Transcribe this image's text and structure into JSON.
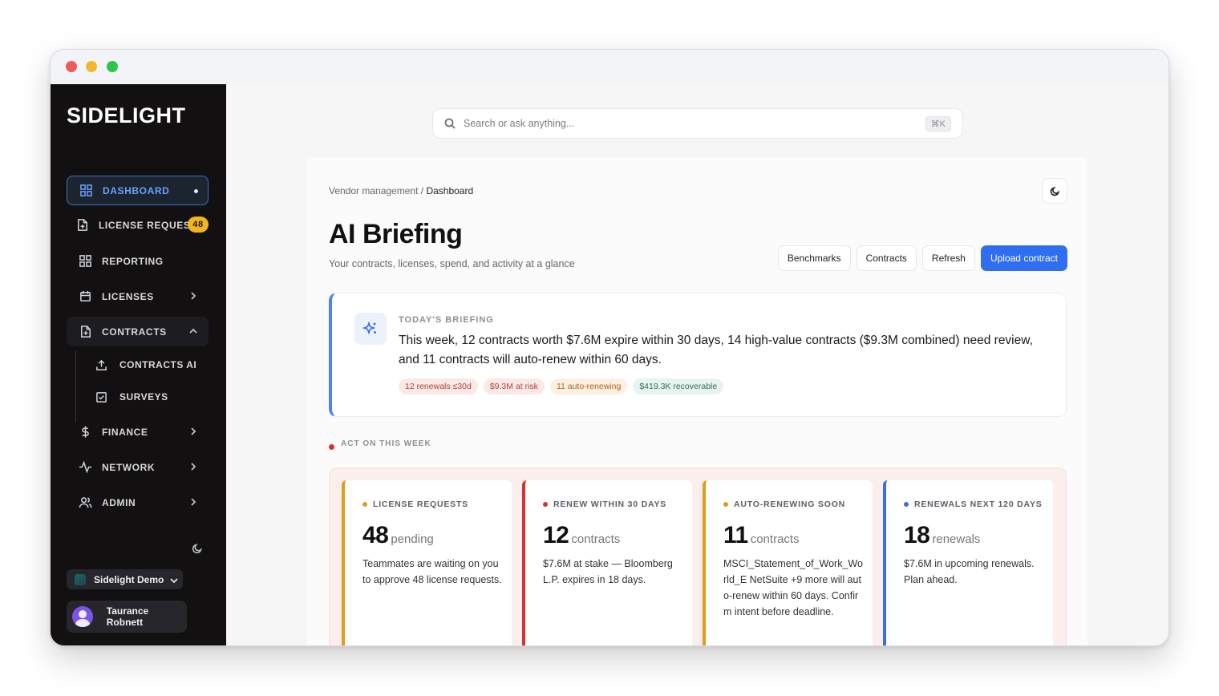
{
  "colors": {
    "accent": "#2f6ef0",
    "sidebar_bg": "#121011",
    "badge": "#f3b51e",
    "danger": "#d8322e",
    "warning": "#e29c17"
  },
  "sidebar": {
    "logo": "SIDELIGHT",
    "items": [
      {
        "label": "DASHBOARD",
        "icon": "grid-icon"
      },
      {
        "label": "LICENSE REQUESTS",
        "icon": "file-plus-icon",
        "badge": "48"
      },
      {
        "label": "REPORTING",
        "icon": "grid-icon"
      },
      {
        "label": "LICENSES",
        "icon": "calendar-icon"
      },
      {
        "label": "CONTRACTS",
        "icon": "file-plus-icon"
      },
      {
        "label": "FINANCE",
        "icon": "dollar-icon"
      },
      {
        "label": "NETWORK",
        "icon": "activity-icon"
      },
      {
        "label": "ADMIN",
        "icon": "users-icon"
      }
    ],
    "sub_items": [
      {
        "label": "CONTRACTS AI",
        "icon": "upload-icon"
      },
      {
        "label": "SURVEYS",
        "icon": "checkbox-icon"
      }
    ],
    "org": "Sidelight Demo",
    "user": "Taurance Robnett"
  },
  "search": {
    "placeholder": "Search or ask anything...",
    "shortcut": "⌘K"
  },
  "breadcrumb": {
    "parent": "Vendor management",
    "separator": " / ",
    "current": "Dashboard"
  },
  "header": {
    "title": "AI Briefing",
    "subtitle": "Your contracts, licenses, spend, and activity at a glance",
    "buttons": {
      "benchmarks": "Benchmarks",
      "contracts": "Contracts",
      "refresh": "Refresh",
      "upload": "Upload contract"
    }
  },
  "briefing": {
    "label": "TODAY'S BRIEFING",
    "text": "This week, 12 contracts worth $7.6M expire within 30 days, 14 high-value contracts ($9.3M combined) need review, and 11 contracts will auto-renew within 60 days.",
    "tags": [
      "12 renewals ≤30d",
      "$9.3M at risk",
      "11 auto-renewing",
      "$419.3K recoverable"
    ]
  },
  "act_section": {
    "label": "ACT ON THIS WEEK"
  },
  "cards": [
    {
      "title": "LICENSE REQUESTS",
      "number": "48",
      "unit": "pending",
      "desc": "Teammates are waiting on you to approve 48 license requests."
    },
    {
      "title": "RENEW WITHIN 30 DAYS",
      "number": "12",
      "unit": "contracts",
      "desc": "$7.6M at stake — Bloomberg L.P. expires in 18 days."
    },
    {
      "title": "AUTO-RENEWING SOON",
      "number": "11",
      "unit": "contracts",
      "desc": "MSCI_Statement_of_Work_World_E NetSuite +9 more will auto-renew within 60 days. Confirm intent before deadline."
    },
    {
      "title": "RENEWALS NEXT 120 DAYS",
      "number": "18",
      "unit": "renewals",
      "desc": "$7.6M in upcoming renewals. Plan ahead."
    }
  ]
}
